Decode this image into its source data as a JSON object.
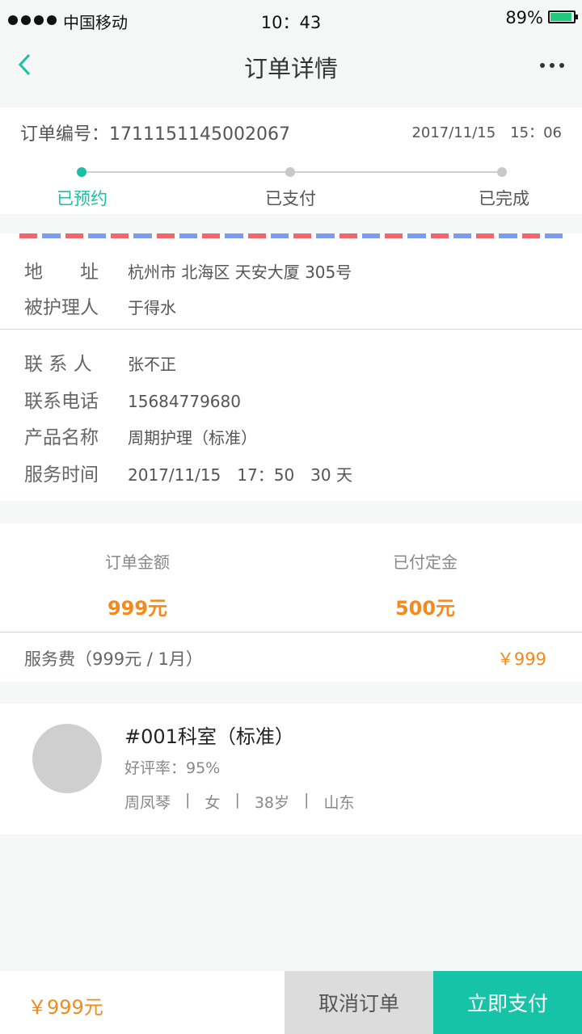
{
  "status_bar": {
    "carrier": "中国移动",
    "time": "10：43",
    "battery": "89%",
    "battery_color": "#22c97a"
  },
  "nav": {
    "title": "订单详情",
    "back_icon": "chevron-left-icon",
    "more_icon": "more-icon"
  },
  "order": {
    "number_label": "订单编号：1711151145002067",
    "datetime": "2017/11/15　15：06",
    "steps": [
      {
        "label": "已预约",
        "active": true
      },
      {
        "label": "已支付",
        "active": false
      },
      {
        "label": "已完成",
        "active": false
      }
    ],
    "accent_color": "#1cbfa4"
  },
  "address": {
    "rows": [
      {
        "label": "地　　址",
        "value": "杭州市  北海区 天安大厦 305号"
      },
      {
        "label": "被护理人",
        "value": "于得水"
      }
    ]
  },
  "details": {
    "rows": [
      {
        "label": "联 系 人",
        "value": "张不正"
      },
      {
        "label": "联系电话",
        "value": "15684779680"
      },
      {
        "label": "产品名称",
        "value": "周期护理（标准）"
      },
      {
        "label": "服务时间",
        "value": "2017/11/15　17：50　30 天"
      }
    ]
  },
  "fees": {
    "order_amount_label": "订单金额",
    "order_amount": "999元",
    "deposit_label": "已付定金",
    "deposit": "500元",
    "service_label": "服务费（999元 / 1月）",
    "service_amount": "￥999",
    "amount_color": "#f28a1e"
  },
  "staff": {
    "title": "#001科室（标准）",
    "rating": "好评率：95%",
    "meta": [
      "周凤琴",
      "女",
      "38岁",
      "山东"
    ]
  },
  "bottom": {
    "total": "￥999元",
    "cancel_label": "取消订单",
    "pay_label": "立即支付",
    "pay_color": "#17c3a6"
  }
}
